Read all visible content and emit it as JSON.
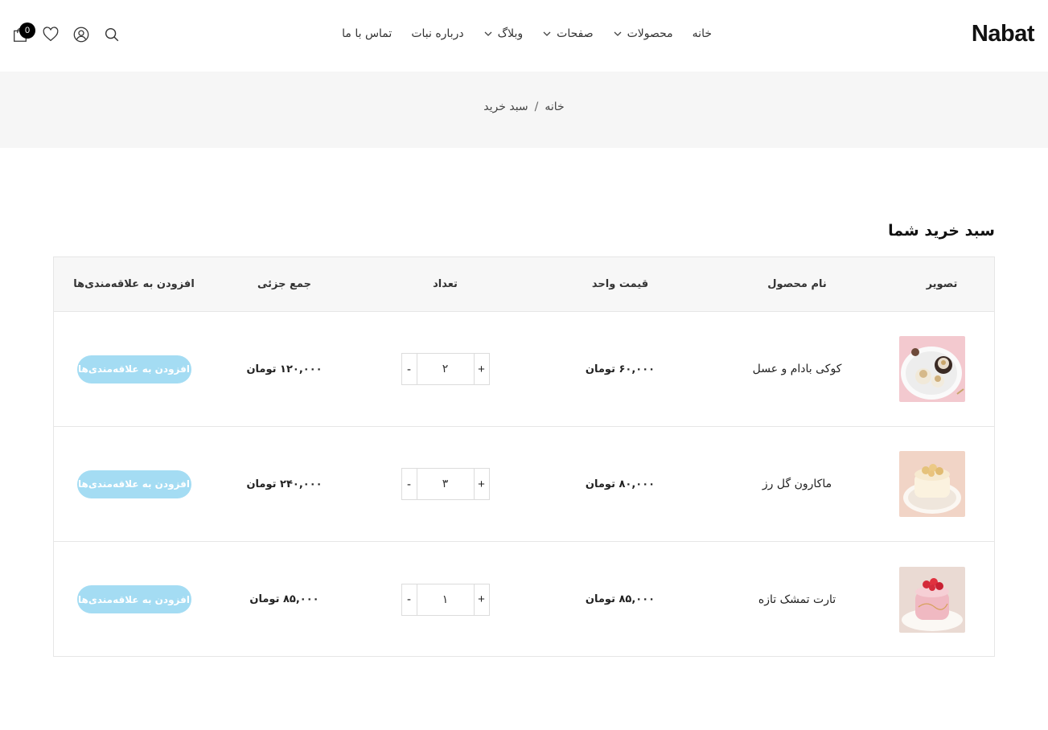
{
  "header": {
    "logo": "Nabat",
    "nav": [
      {
        "label": "خانه",
        "dropdown": false
      },
      {
        "label": "محصولات",
        "dropdown": true
      },
      {
        "label": "صفحات",
        "dropdown": true
      },
      {
        "label": "وبلاگ",
        "dropdown": true
      },
      {
        "label": "درباره نبات",
        "dropdown": false
      },
      {
        "label": "تماس با ما",
        "dropdown": false
      }
    ],
    "cart_count": "0",
    "icons": [
      "search-icon",
      "user-icon",
      "heart-icon",
      "cart-icon"
    ]
  },
  "breadcrumb": {
    "home": "خانه",
    "separator": "/",
    "current": "سبد خرید"
  },
  "cart": {
    "title": "سبد خرید شما",
    "columns": {
      "image": "تصویر",
      "name": "نام محصول",
      "price": "قیمت واحد",
      "qty": "تعداد",
      "subtotal": "جمع جزئی",
      "wishlist": "افزودن به علاقه‌مندی‌ها"
    },
    "items": [
      {
        "name": "کوکی بادام و عسل",
        "price": "۶۰,۰۰۰ تومان",
        "qty": "۲",
        "subtotal": "۱۲۰,۰۰۰ تومان",
        "wish_label": "افزودن به علاقه‌مندی‌ها",
        "plus": "+",
        "minus": "-"
      },
      {
        "name": "ماکارون گل رز",
        "price": "۸۰,۰۰۰ تومان",
        "qty": "۳",
        "subtotal": "۲۴۰,۰۰۰ تومان",
        "wish_label": "افزودن به علاقه‌مندی‌ها",
        "plus": "+",
        "minus": "-"
      },
      {
        "name": "تارت تمشک تازه",
        "price": "۸۵,۰۰۰ تومان",
        "qty": "۱",
        "subtotal": "۸۵,۰۰۰ تومان",
        "wish_label": "افزودن به علاقه‌مندی‌ها",
        "plus": "+",
        "minus": "-"
      }
    ]
  },
  "colors": {
    "accent": "#a4dcf3",
    "breadcrumb_bg": "#f6f6f6",
    "table_header_bg": "#f7f7f7",
    "badge": "#000000"
  }
}
